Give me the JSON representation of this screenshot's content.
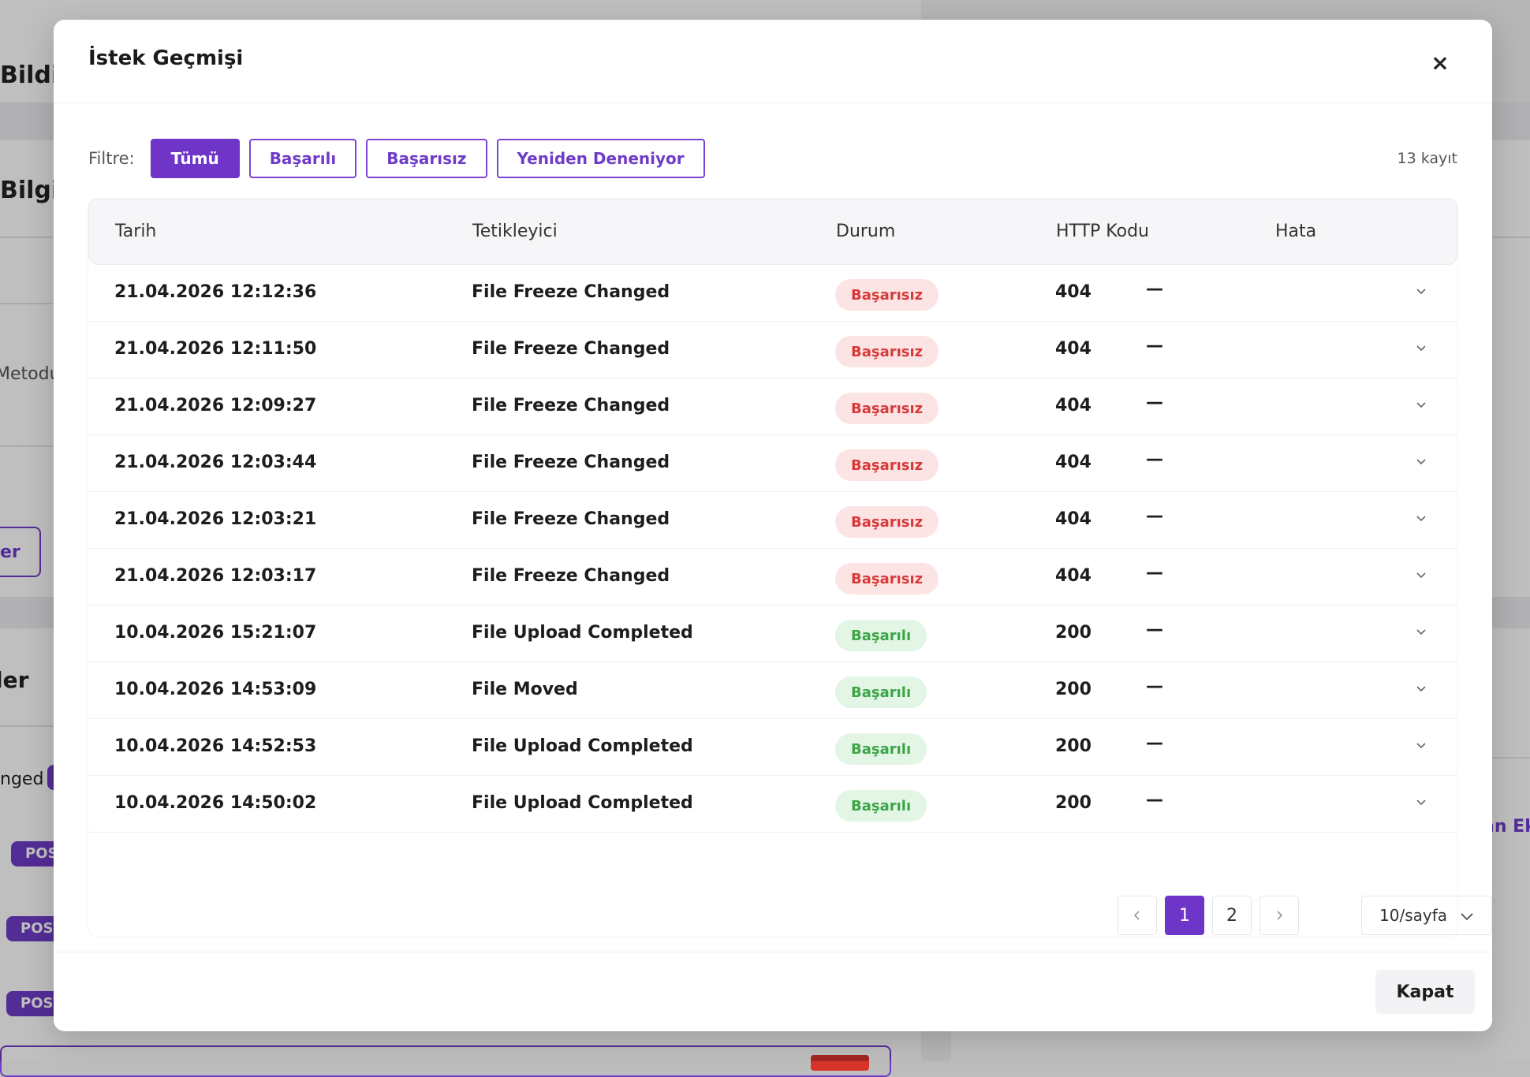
{
  "background": {
    "heading_1": "Bildi",
    "heading_2": "Bilgile",
    "label_method": "Metodu",
    "outline_button": "er",
    "heading_3": "ler",
    "event_text": "nged",
    "post_badge": "POST",
    "link_text": "an Ek"
  },
  "modal": {
    "title": "İstek Geçmişi",
    "close_icon": "×"
  },
  "filters": {
    "label": "Filtre:",
    "buttons": [
      {
        "label": "Tümü",
        "active": true
      },
      {
        "label": "Başarılı",
        "active": false
      },
      {
        "label": "Başarısız",
        "active": false
      },
      {
        "label": "Yeniden Deneniyor",
        "active": false
      }
    ],
    "record_count": "13 kayıt"
  },
  "table": {
    "columns": [
      "Tarih",
      "Tetikleyici",
      "Durum",
      "HTTP Kodu",
      "Hata"
    ],
    "rows": [
      {
        "date": "21.04.2026 12:12:36",
        "trigger": "File Freeze Changed",
        "status": "Başarısız",
        "status_type": "fail",
        "code": "404",
        "error": "—"
      },
      {
        "date": "21.04.2026 12:11:50",
        "trigger": "File Freeze Changed",
        "status": "Başarısız",
        "status_type": "fail",
        "code": "404",
        "error": "—"
      },
      {
        "date": "21.04.2026 12:09:27",
        "trigger": "File Freeze Changed",
        "status": "Başarısız",
        "status_type": "fail",
        "code": "404",
        "error": "—"
      },
      {
        "date": "21.04.2026 12:03:44",
        "trigger": "File Freeze Changed",
        "status": "Başarısız",
        "status_type": "fail",
        "code": "404",
        "error": "—"
      },
      {
        "date": "21.04.2026 12:03:21",
        "trigger": "File Freeze Changed",
        "status": "Başarısız",
        "status_type": "fail",
        "code": "404",
        "error": "—"
      },
      {
        "date": "21.04.2026 12:03:17",
        "trigger": "File Freeze Changed",
        "status": "Başarısız",
        "status_type": "fail",
        "code": "404",
        "error": "—"
      },
      {
        "date": "10.04.2026 15:21:07",
        "trigger": "File Upload Completed",
        "status": "Başarılı",
        "status_type": "ok",
        "code": "200",
        "error": "—"
      },
      {
        "date": "10.04.2026 14:53:09",
        "trigger": "File Moved",
        "status": "Başarılı",
        "status_type": "ok",
        "code": "200",
        "error": "—"
      },
      {
        "date": "10.04.2026 14:52:53",
        "trigger": "File Upload Completed",
        "status": "Başarılı",
        "status_type": "ok",
        "code": "200",
        "error": "—"
      },
      {
        "date": "10.04.2026 14:50:02",
        "trigger": "File Upload Completed",
        "status": "Başarılı",
        "status_type": "ok",
        "code": "200",
        "error": "—"
      }
    ]
  },
  "pagination": {
    "prev_icon": "chevron-left-icon",
    "pages": [
      "1",
      "2"
    ],
    "current_page": "1",
    "next_icon": "chevron-right-icon",
    "page_size": "10/sayfa"
  },
  "footer": {
    "close_label": "Kapat"
  },
  "colors": {
    "accent": "#6f35c9",
    "fail_bg": "#fde4e4",
    "fail_text": "#d83a3a",
    "ok_bg": "#e3f5e4",
    "ok_text": "#3ba647"
  }
}
